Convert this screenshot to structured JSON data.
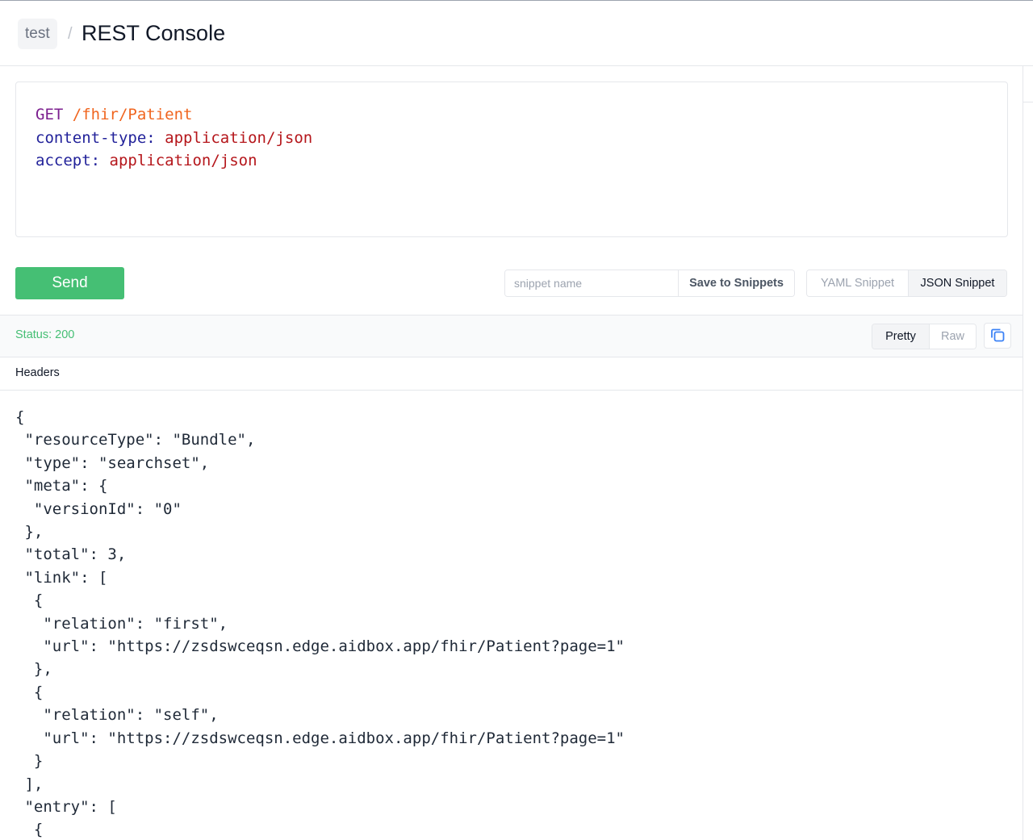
{
  "breadcrumb": {
    "parent": "test",
    "separator": "/",
    "title": "REST Console"
  },
  "request": {
    "method": "GET",
    "path": "/fhir/Patient",
    "headers": [
      {
        "key": "content-type",
        "value": "application/json"
      },
      {
        "key": "accept",
        "value": "application/json"
      }
    ]
  },
  "actions": {
    "send_label": "Send",
    "snippet_placeholder": "snippet name",
    "snippet_value": "",
    "save_label": "Save to Snippets",
    "yaml_label": "YAML Snippet",
    "json_label": "JSON Snippet",
    "active_format": "JSON Snippet"
  },
  "response": {
    "status": "Status: 200",
    "pretty_label": "Pretty",
    "raw_label": "Raw",
    "active_view": "Pretty",
    "headers_label": "Headers",
    "body_lines": [
      "{",
      " \"resourceType\": \"Bundle\",",
      " \"type\": \"searchset\",",
      " \"meta\": {",
      "  \"versionId\": \"0\"",
      " },",
      " \"total\": 3,",
      " \"link\": [",
      "  {",
      "   \"relation\": \"first\",",
      "   \"url\": \"https://zsdswceqsn.edge.aidbox.app/fhir/Patient?page=1\"",
      "  },",
      "  {",
      "   \"relation\": \"self\",",
      "   \"url\": \"https://zsdswceqsn.edge.aidbox.app/fhir/Patient?page=1\"",
      "  }",
      " ],",
      " \"entry\": [",
      "  {"
    ]
  },
  "colors": {
    "send_button": "#45bf74",
    "status_ok": "#45bf74",
    "method": "#7c1f8f",
    "path": "#f0651f",
    "header_key": "#22229a",
    "header_value": "#b5161b",
    "copy_icon": "#3b82f6"
  },
  "icons": {
    "copy": "copy-icon"
  }
}
